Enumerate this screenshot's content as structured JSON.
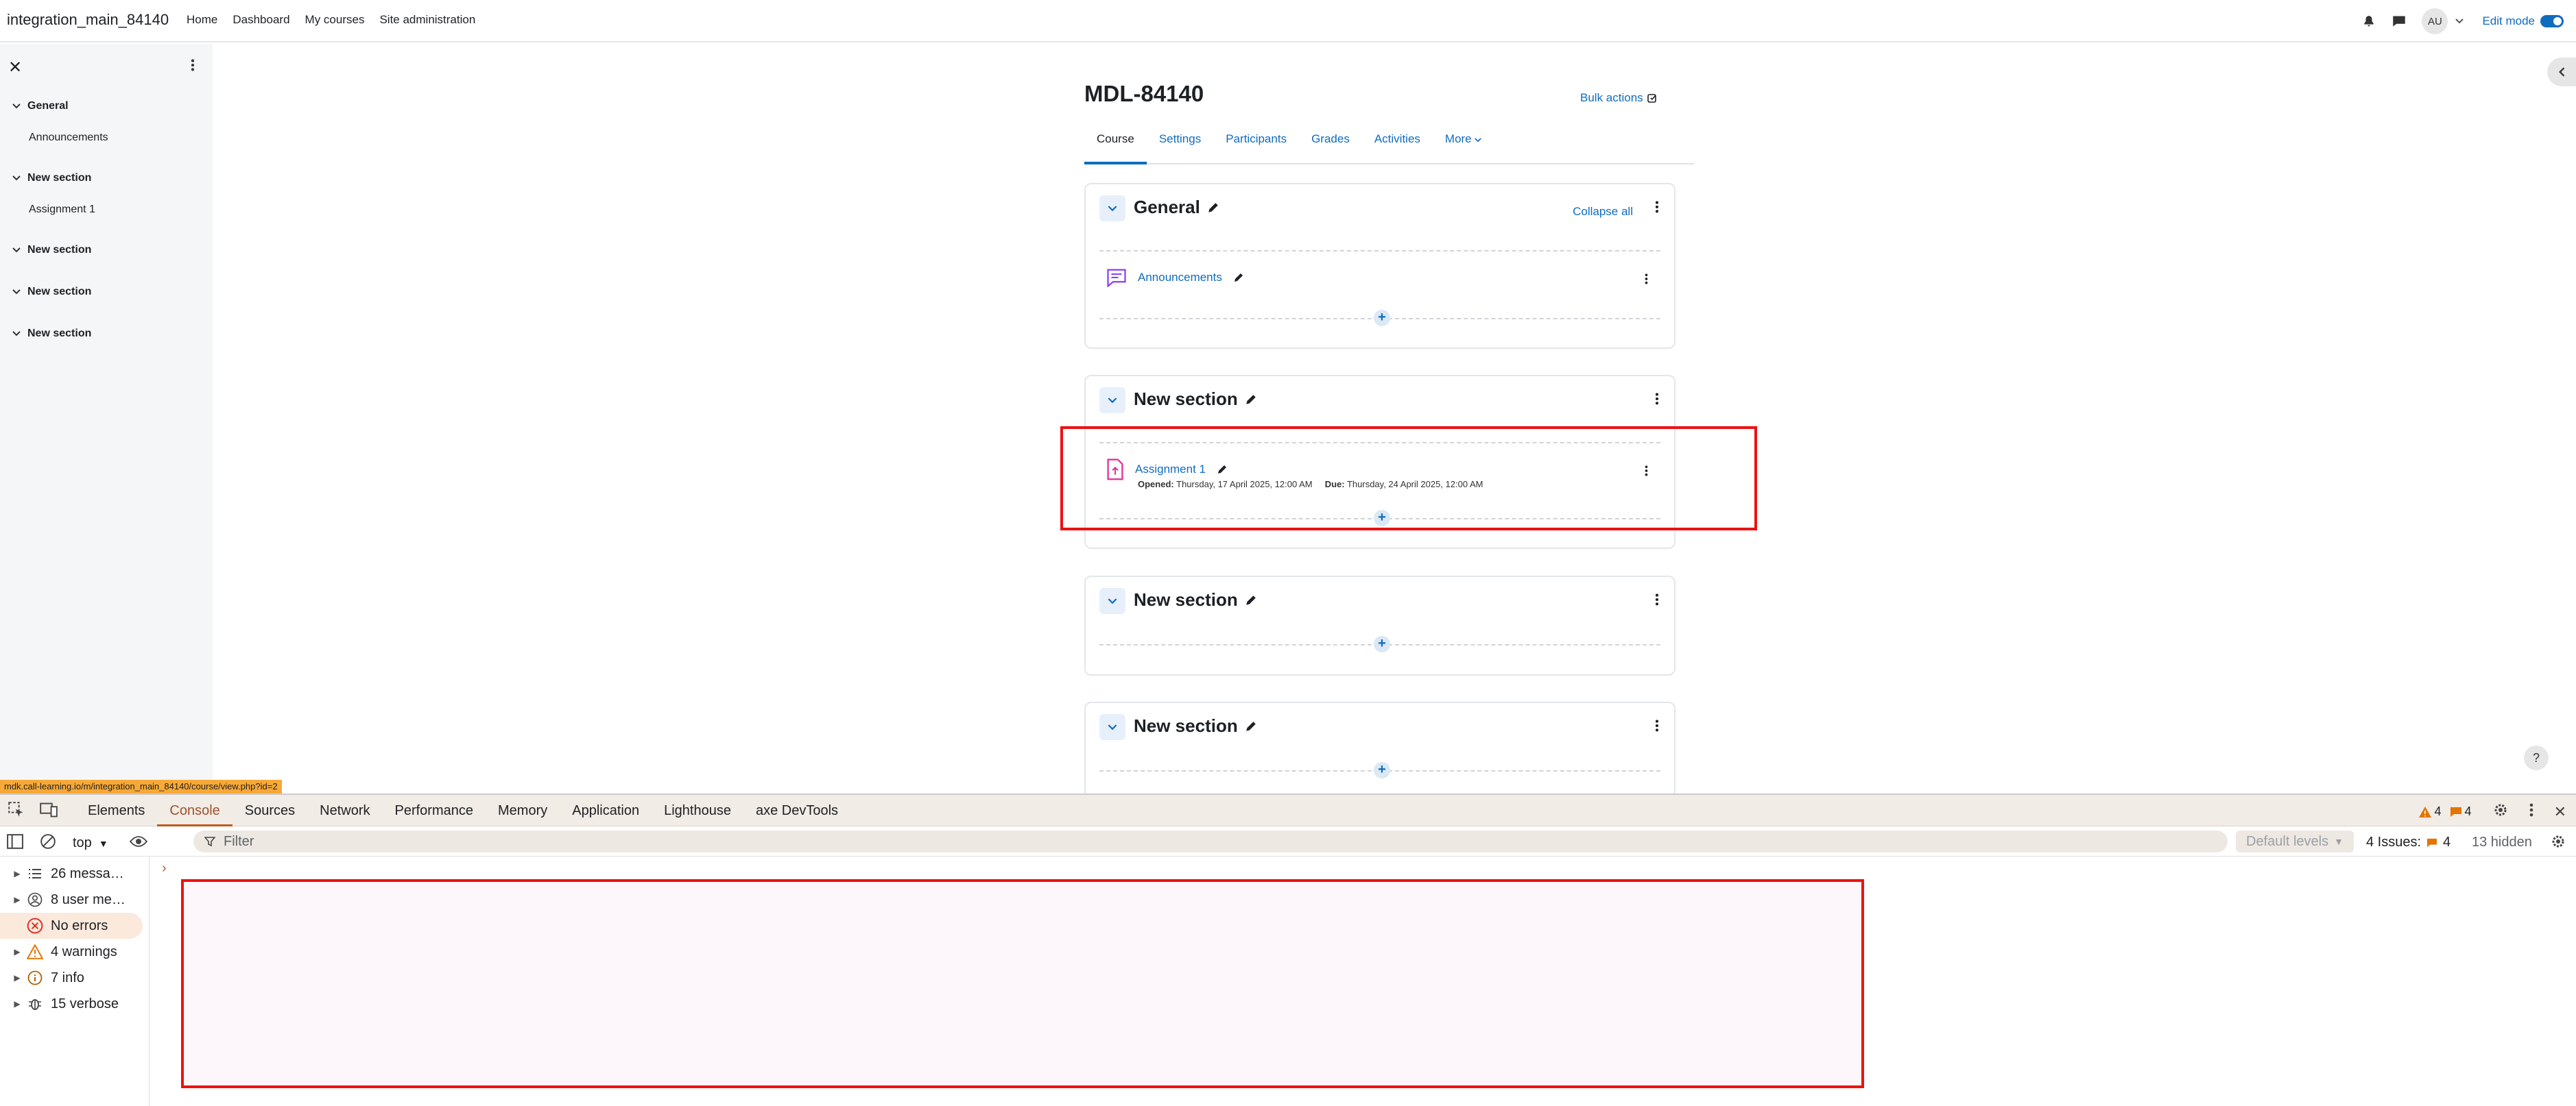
{
  "navbar": {
    "site_name": "integration_main_84140",
    "links": [
      "Home",
      "Dashboard",
      "My courses",
      "Site administration"
    ],
    "avatar_initials": "AU",
    "edit_mode_label": "Edit mode"
  },
  "course_index": {
    "entries": [
      {
        "section": "General",
        "items": [
          "Announcements"
        ]
      },
      {
        "section": "New section",
        "items": [
          "Assignment 1"
        ]
      },
      {
        "section": "New section",
        "items": []
      },
      {
        "section": "New section",
        "items": []
      },
      {
        "section": "New section",
        "items": []
      }
    ]
  },
  "course": {
    "title": "MDL-84140",
    "bulk_actions": "Bulk actions",
    "tabs": [
      "Course",
      "Settings",
      "Participants",
      "Grades",
      "Activities",
      "More"
    ],
    "collapse_all": "Collapse all",
    "sections": [
      {
        "title": "General",
        "activities": [
          {
            "name": "Announcements"
          }
        ]
      },
      {
        "title": "New section",
        "activities": [
          {
            "name": "Assignment 1",
            "opened_label": "Opened:",
            "opened": "Thursday, 17 April 2025, 12:00 AM",
            "due_label": "Due:",
            "due": "Thursday, 24 April 2025, 12:00 AM"
          }
        ]
      },
      {
        "title": "New section",
        "activities": []
      },
      {
        "title": "New section",
        "activities": []
      }
    ]
  },
  "status_url": "mdk.call-learning.io/m/integration_main_84140/course/view.php?id=2",
  "help_label": "?",
  "devtools": {
    "tabs": [
      "Elements",
      "Console",
      "Sources",
      "Network",
      "Performance",
      "Memory",
      "Application",
      "Lighthouse",
      "axe DevTools"
    ],
    "warning_count": "4",
    "info_count": "4",
    "context": "top",
    "filter_placeholder": "Filter",
    "levels": "Default levels",
    "issues_label": "4 Issues:",
    "issues_count": "4",
    "hidden": "13 hidden",
    "sidebar": [
      "26 messa…",
      "8 user me…",
      "No errors",
      "4 warnings",
      "7 info",
      "15 verbose"
    ]
  },
  "colors": {
    "accent": "#0f6cbf",
    "highlight": "#ee1111",
    "devtools_active": "#c05a1e"
  }
}
